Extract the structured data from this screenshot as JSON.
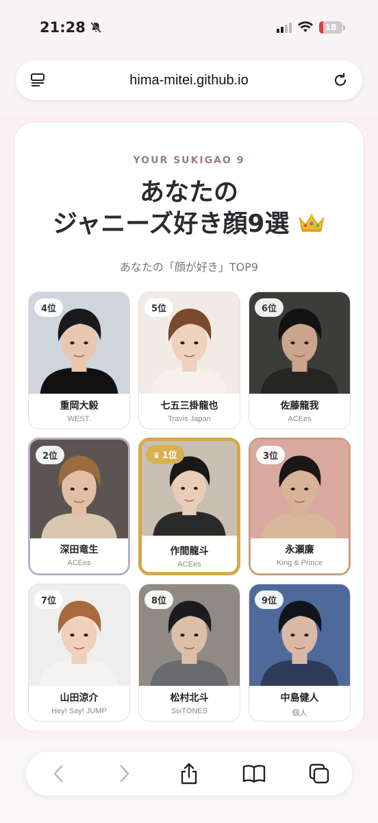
{
  "status": {
    "time": "21:28",
    "battery": "18"
  },
  "browser": {
    "url": "hima-mitei.github.io"
  },
  "page": {
    "eyebrow": "YOUR SUKIGAO 9",
    "title_line1": "あなたの",
    "title_line2": "ジャニーズ好き顔9選",
    "subtitle": "あなたの「顔が好き」TOP9"
  },
  "tiles": [
    {
      "rank": "4位",
      "name": "重岡大毅",
      "group": "WEST.",
      "style": "normal",
      "bg": "#cfd5dd",
      "hair": "#1a1a1e",
      "skin": "#e8c7b0",
      "cloth": "#111"
    },
    {
      "rank": "5位",
      "name": "七五三掛龍也",
      "group": "Travis Japan",
      "style": "normal",
      "bg": "#f1ebe6",
      "hair": "#7a4a2c",
      "skin": "#efd2bd",
      "cloth": "#f5f1ea"
    },
    {
      "rank": "6位",
      "name": "佐藤龍我",
      "group": "ACEes",
      "style": "normal",
      "bg": "#3c3d38",
      "hair": "#121212",
      "skin": "#caa58c",
      "cloth": "#252622"
    },
    {
      "rank": "2位",
      "name": "深田竜生",
      "group": "ACEes",
      "style": "silver",
      "bg": "#5a5552",
      "hair": "#9c6a3e",
      "skin": "#e2bfa4",
      "cloth": "#d8c7ad"
    },
    {
      "rank": "1位",
      "name": "作間龍斗",
      "group": "ACEes",
      "style": "gold",
      "bg": "#c9bfb3",
      "hair": "#181818",
      "skin": "#e9cdb8",
      "cloth": "#2a2a2a"
    },
    {
      "rank": "3位",
      "name": "永瀬廉",
      "group": "King & Prince",
      "style": "bronze",
      "bg": "#d9a9a0",
      "hair": "#1b1714",
      "skin": "#d9b397",
      "cloth": "#d7b89a"
    },
    {
      "rank": "7位",
      "name": "山田涼介",
      "group": "Hey! Say! JUMP",
      "style": "normal",
      "bg": "#eeeeee",
      "hair": "#a8693c",
      "skin": "#efd0ba",
      "cloth": "#f3f3f3"
    },
    {
      "rank": "8位",
      "name": "松村北斗",
      "group": "SixTONES",
      "style": "normal",
      "bg": "#8f8a84",
      "hair": "#1c1c1f",
      "skin": "#dcbfa8",
      "cloth": "#6a6b6e"
    },
    {
      "rank": "9位",
      "name": "中島健人",
      "group": "個人",
      "style": "normal",
      "bg": "#4d6a9a",
      "hair": "#111418",
      "skin": "#d9b9a6",
      "cloth": "#2f3b58"
    }
  ],
  "colors": {
    "gold": "#d4a94a",
    "accent": "#9b7b88"
  }
}
